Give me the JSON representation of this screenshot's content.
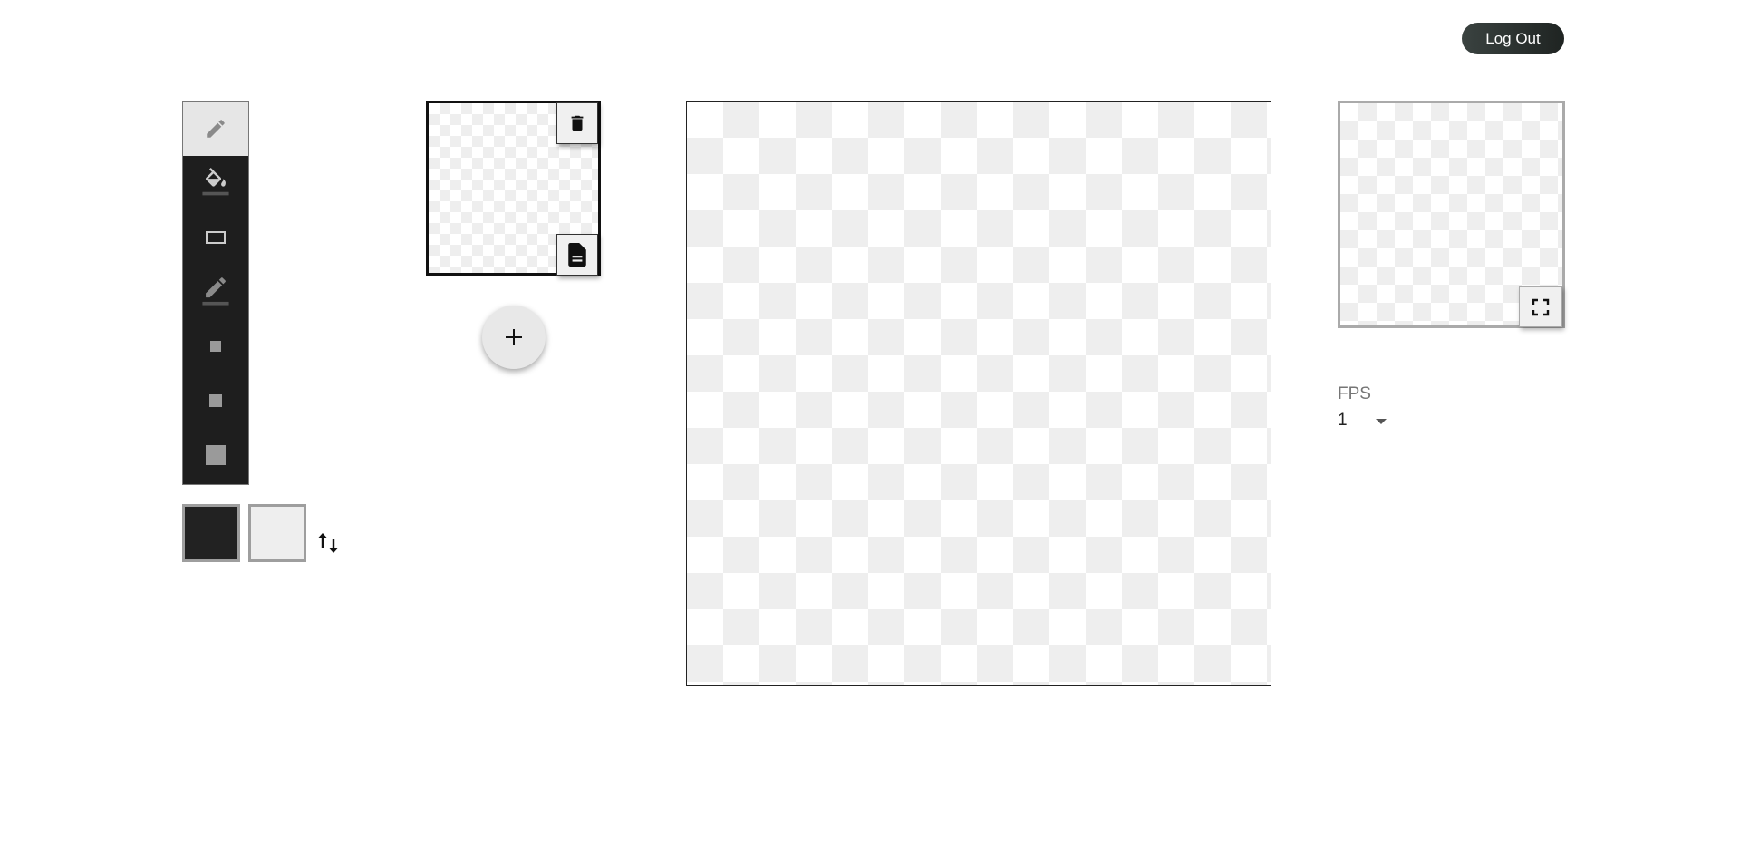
{
  "header": {
    "logout_label": "Log Out"
  },
  "toolbar": {
    "tools": [
      {
        "name": "pencil",
        "icon": "pencil-icon",
        "active": true
      },
      {
        "name": "fill",
        "icon": "paint-bucket-icon",
        "active": false
      },
      {
        "name": "rectangle",
        "icon": "rectangle-icon",
        "active": false
      },
      {
        "name": "line",
        "icon": "line-pen-icon",
        "active": false
      },
      {
        "name": "brush-small",
        "icon": "square-small-icon",
        "active": false
      },
      {
        "name": "brush-medium",
        "icon": "square-medium-icon",
        "active": false
      },
      {
        "name": "brush-large",
        "icon": "square-large-icon",
        "active": false
      }
    ]
  },
  "colors": {
    "primary": "#222222",
    "secondary": "#eeeeee",
    "swap_icon": "swap-vertical-icon"
  },
  "frames": {
    "items": [
      {
        "delete_icon": "trash-icon",
        "duplicate_icon": "file-document-icon"
      }
    ],
    "add_icon": "plus-icon"
  },
  "preview": {
    "fullscreen_icon": "fullscreen-icon"
  },
  "fps": {
    "label": "FPS",
    "value": "1"
  }
}
